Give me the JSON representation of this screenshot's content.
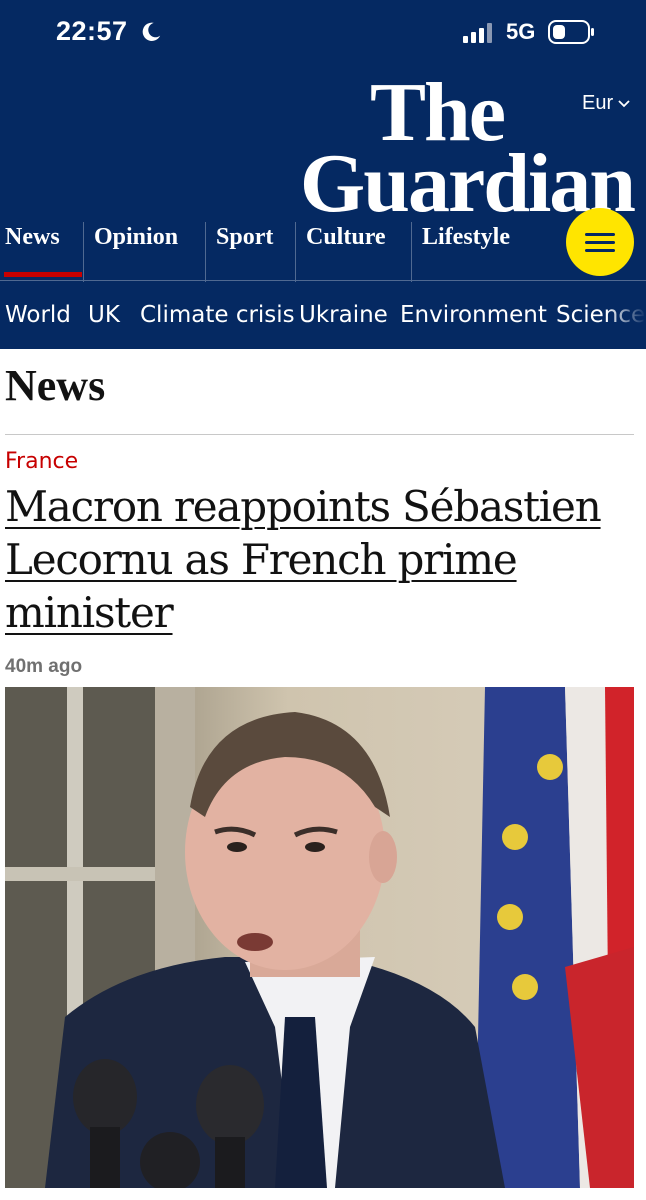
{
  "status_bar": {
    "time": "22:57",
    "network": "5G"
  },
  "header": {
    "edition": "Eur",
    "logo": {
      "line1": "The",
      "line2": "Guardian"
    }
  },
  "pillars": [
    {
      "label": "News",
      "active": true
    },
    {
      "label": "Opinion"
    },
    {
      "label": "Sport"
    },
    {
      "label": "Culture"
    },
    {
      "label": "Lifestyle"
    }
  ],
  "subnav": [
    "World",
    "UK",
    "Climate crisis",
    "Ukraine",
    "Environment",
    "Science"
  ],
  "section": {
    "title": "News"
  },
  "article": {
    "kicker": "France",
    "headline": "Macron reappoints Sébastien Lecornu as French prime minister",
    "age": "40m ago"
  },
  "colors": {
    "brand_blue": "#052962",
    "accent_red": "#c70000",
    "menu_yellow": "#ffe500"
  },
  "icons": [
    "moon-icon",
    "signal-icon",
    "battery-icon",
    "chevron-down-icon",
    "menu-icon"
  ]
}
